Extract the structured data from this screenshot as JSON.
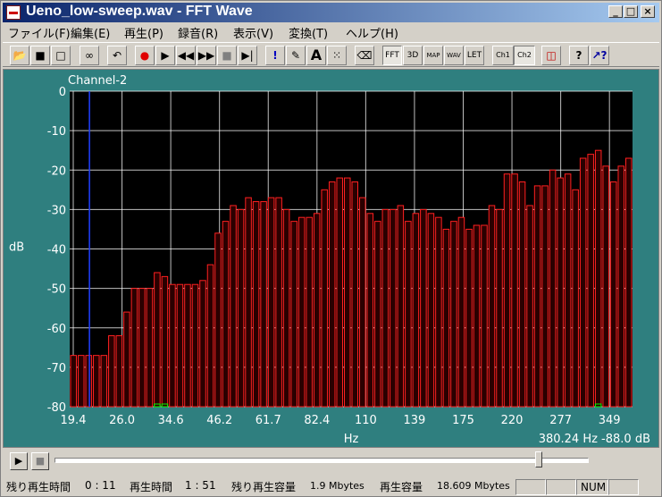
{
  "window": {
    "title": "Ueno_low-sweep.wav - FFT Wave",
    "min_label": "_",
    "max_label": "□",
    "close_label": "×"
  },
  "menu": [
    {
      "label": "ファイル(F)"
    },
    {
      "label": "編集(E)"
    },
    {
      "label": "再生(P)"
    },
    {
      "label": "録音(R)"
    },
    {
      "label": "表示(V)"
    },
    {
      "label": "変換(T)"
    },
    {
      "label": "ヘルプ(H)"
    }
  ],
  "toolbar": {
    "fft": "FFT",
    "threed": "3D",
    "map": "MAP",
    "wav": "WAV",
    "let": "LET",
    "ch1": "Ch1",
    "ch2": "Ch2",
    "info": "!",
    "text": "A",
    "help": "?"
  },
  "colors": {
    "plot_bg": "#000000",
    "frame_bg": "#2f7f7f",
    "bar_outline": "#ff2020",
    "bar_fill": "#2a0000",
    "grid": "#ffffff",
    "cursor": "#2040ff",
    "green_marker": "#00ff00"
  },
  "chart_data": {
    "type": "bar",
    "title": "Channel-2",
    "xlabel": "Hz",
    "ylabel": "dB",
    "ylim": [
      -80,
      0
    ],
    "yticks": [
      "0",
      "-10",
      "-20",
      "-30",
      "-40",
      "-50",
      "-60",
      "-70",
      "-80"
    ],
    "xticks": [
      "19.4",
      "26.0",
      "34.6",
      "46.2",
      "61.7",
      "82.4",
      "110",
      "139",
      "175",
      "220",
      "277",
      "349"
    ],
    "values": [
      -67,
      -67,
      -67,
      -67,
      -67,
      -62,
      -62,
      -56,
      -50,
      -50,
      -50,
      -46,
      -47,
      -49,
      -49,
      -49,
      -49,
      -48,
      -44,
      -36,
      -33,
      -29,
      -30,
      -27,
      -28,
      -28,
      -27,
      -27,
      -30,
      -33,
      -32,
      -32,
      -31,
      -25,
      -23,
      -22,
      -22,
      -23,
      -27,
      -31,
      -33,
      -30,
      -30,
      -29,
      -33,
      -31,
      -30,
      -31,
      -32,
      -35,
      -33,
      -32,
      -35,
      -34,
      -34,
      -29,
      -30,
      -21,
      -21,
      -23,
      -29,
      -24,
      -24,
      -20,
      -22,
      -21,
      -25,
      -17,
      -16,
      -15,
      -19,
      -23,
      -19,
      -17
    ],
    "green_markers": [
      11,
      12,
      69
    ],
    "cursor_index": 2,
    "readout": "380.24  Hz -88.0  dB",
    "grid": true
  },
  "status": {
    "remain_play_time_label": "残り再生時間",
    "remain_play_time": "0 : 11",
    "play_time_label": "再生時間",
    "play_time": "1 : 51",
    "remain_capacity_label": "残り再生容量",
    "remain_capacity": "1.9 Mbytes",
    "capacity_label": "再生容量",
    "capacity": "18.609 Mbytes",
    "num": "NUM"
  },
  "playback": {
    "progress": 0.91
  }
}
